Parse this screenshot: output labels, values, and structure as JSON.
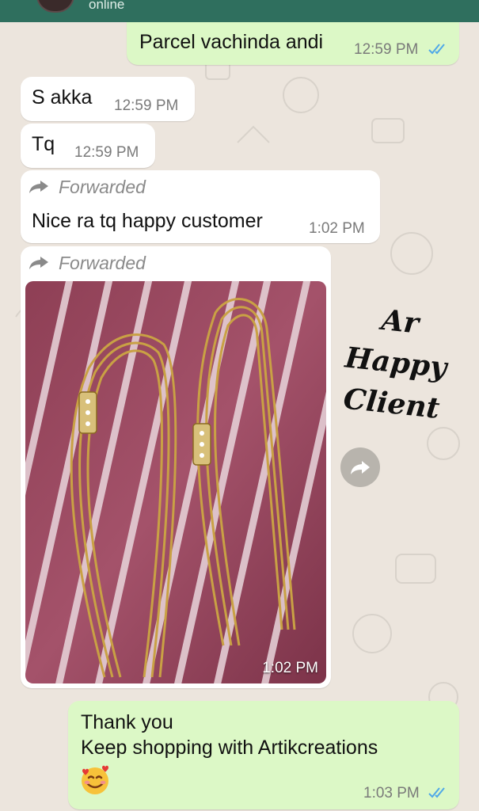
{
  "header": {
    "status": "online"
  },
  "messages": [
    {
      "direction": "outgoing",
      "text": "Parcel vachinda andi",
      "time": "12:59 PM",
      "read": true
    },
    {
      "direction": "incoming",
      "text": "S akka",
      "time": "12:59 PM"
    },
    {
      "direction": "incoming",
      "text": "Tq",
      "time": "12:59 PM"
    },
    {
      "direction": "incoming",
      "forwarded_label": "Forwarded",
      "text": "Nice ra tq happy customer",
      "time": "1:02 PM"
    },
    {
      "direction": "incoming",
      "forwarded_label": "Forwarded",
      "type": "image",
      "time": "1:02 PM"
    },
    {
      "direction": "outgoing",
      "lines": [
        "Thank you",
        "Keep shopping with Artikcreations"
      ],
      "emoji": "smiling-face-with-hearts",
      "time": "1:03 PM",
      "read": true
    }
  ],
  "overlay": {
    "lines": [
      "Ar",
      "Happy",
      "Client"
    ]
  },
  "icons": {
    "forward": "forward-arrow-icon",
    "share": "share-forward-icon",
    "ticks": "double-check-icon"
  },
  "colors": {
    "outgoing_bubble": "#dcf8c6",
    "incoming_bubble": "#ffffff",
    "chat_background": "#ece5dd",
    "read_ticks": "#4fa8e8",
    "header": "#2f6f5e"
  }
}
